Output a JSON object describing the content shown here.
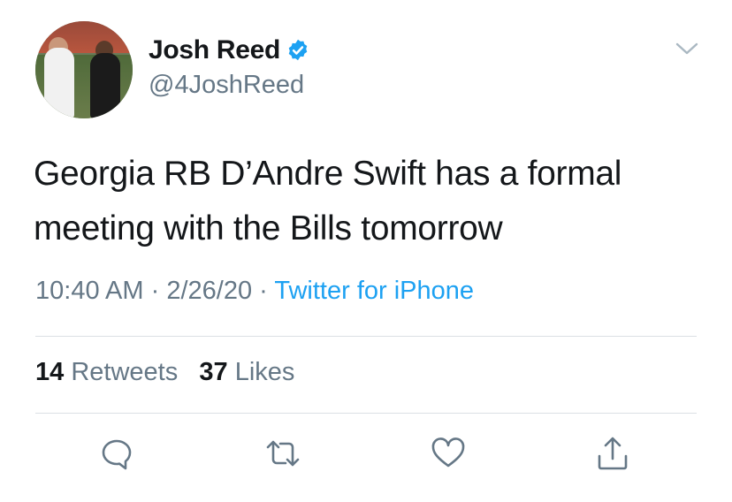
{
  "author": {
    "display_name": "Josh Reed",
    "handle": "@4JoshReed",
    "verified": true,
    "avatar": "profile-photo-two-people-at-stadium"
  },
  "tweet": {
    "text": "Georgia RB D’Andre Swift has a formal meeting with the Bills tomorrow",
    "time": "10:40 AM",
    "date": "2/26/20",
    "sep1": "·",
    "sep2": "·",
    "source": "Twitter for iPhone"
  },
  "stats": {
    "retweets_count": "14",
    "retweets_label": "Retweets",
    "likes_count": "37",
    "likes_label": "Likes"
  },
  "actions": {
    "reply": "reply-icon",
    "retweet": "retweet-icon",
    "like": "heart-icon",
    "share": "share-icon",
    "menu": "chevron-down-icon"
  },
  "colors": {
    "text": "#14171a",
    "secondary": "#657786",
    "accent": "#1da1f2",
    "divider": "#dbe0e4"
  }
}
